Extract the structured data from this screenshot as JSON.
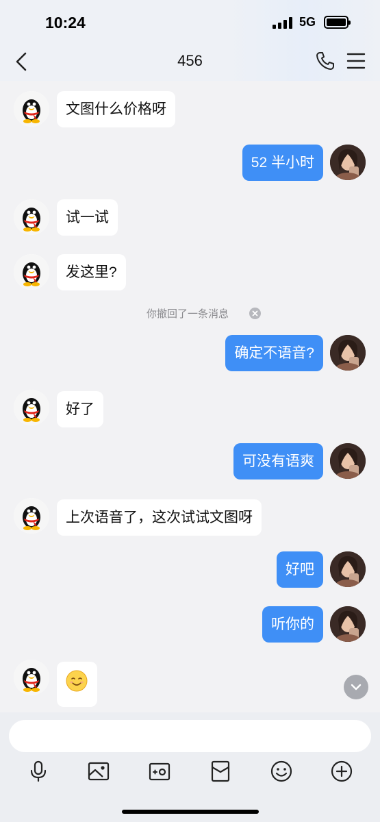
{
  "status_bar": {
    "time": "10:24",
    "network": "5G"
  },
  "header": {
    "title": "456"
  },
  "messages": [
    {
      "side": "in",
      "text": "文图什么价格呀"
    },
    {
      "side": "out",
      "text": "52 半小时"
    },
    {
      "side": "in",
      "text": "试一试"
    },
    {
      "side": "in",
      "text": "发这里?"
    },
    {
      "side": "out",
      "text": "确定不语音?"
    },
    {
      "side": "in",
      "text": "好了"
    },
    {
      "side": "out",
      "text": "可没有语爽"
    },
    {
      "side": "in",
      "text": "上次语音了，这次试试文图呀"
    },
    {
      "side": "out",
      "text": "好吧"
    },
    {
      "side": "out",
      "text": "听你的"
    },
    {
      "side": "in",
      "emoji": "smiling-face"
    }
  ],
  "system_notice": {
    "text": "你撤回了一条消息"
  },
  "input": {
    "placeholder": ""
  },
  "toolbar_icons": [
    "microphone-icon",
    "image-icon",
    "camera-icon",
    "red-packet-icon",
    "emoji-icon",
    "plus-icon"
  ],
  "colors": {
    "outgoing_bubble": "#3f8ff6",
    "incoming_bubble": "#ffffff",
    "background": "#f2f2f4"
  }
}
